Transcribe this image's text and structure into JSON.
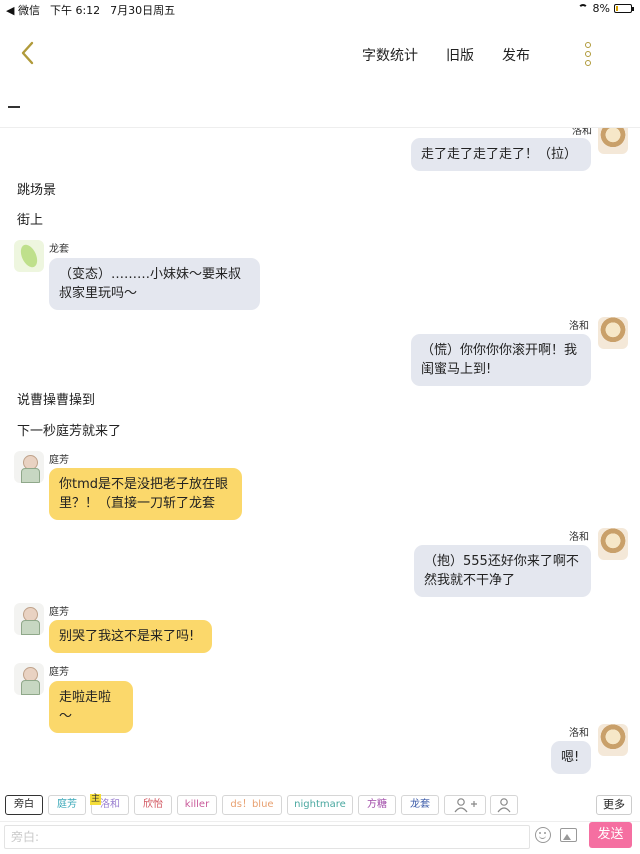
{
  "status": {
    "carrier": "◀ 微信",
    "time": "下午 6:12",
    "date": "7月30日周五",
    "battery": "8%"
  },
  "header": {
    "links": [
      "字数统计",
      "旧版",
      "发布"
    ]
  },
  "chat": {
    "top_cut": {
      "name": "洛和",
      "text": "走了走了走了走了！（拉）"
    },
    "narration_1": "跳场景",
    "narration_2": "街上",
    "msg_long": {
      "name": "龙套",
      "text": "（变态）………小妹妹～要来叔叔家里玩吗～"
    },
    "msg_luo_1": {
      "name": "洛和",
      "text": "（慌）你你你你滚开啊！我闺蜜马上到!"
    },
    "narration_3": "说曹操曹操到",
    "narration_4": "下一秒庭芳就来了",
    "msg_ting_1": {
      "name": "庭芳",
      "text": "你tmd是不是没把老子放在眼里？！（直接一刀斩了龙套"
    },
    "msg_luo_2": {
      "name": "洛和",
      "text": "（抱）555还好你来了啊不然我就不干净了"
    },
    "msg_ting_2": {
      "name": "庭芳",
      "text": "别哭了我这不是来了吗!"
    },
    "msg_ting_3": {
      "name": "庭芳",
      "text": "走啦走啦～"
    },
    "msg_luo_3": {
      "name": "洛和",
      "text": "嗯!"
    }
  },
  "roles": {
    "chips": [
      {
        "label": "旁白",
        "color": "#222222"
      },
      {
        "label": "庭芳",
        "color": "#3aa8b8"
      },
      {
        "label": "洛和",
        "color": "#9a7fd0"
      },
      {
        "label": "欣怡",
        "color": "#d0505a"
      },
      {
        "label": "killer",
        "color": "#c95a9a"
      },
      {
        "label": "ds！blue",
        "color": "#e8a070"
      },
      {
        "label": "nightmare",
        "color": "#4aa8a0"
      },
      {
        "label": "方糖",
        "color": "#a04aa8"
      },
      {
        "label": "龙套",
        "color": "#3a5aa8"
      }
    ],
    "owner_tag": "主",
    "more": "更多"
  },
  "input": {
    "placeholder": "旁白:",
    "send": "发送"
  }
}
